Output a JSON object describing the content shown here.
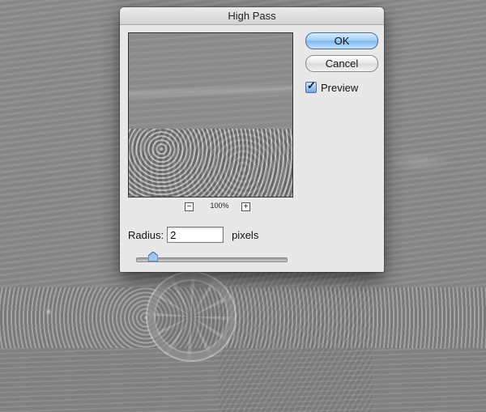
{
  "dialog": {
    "title": "High Pass",
    "ok_label": "OK",
    "cancel_label": "Cancel",
    "preview_label": "Preview",
    "preview_checked": true,
    "zoom_level": "100%",
    "zoom_out_symbol": "−",
    "zoom_in_symbol": "+",
    "radius_label": "Radius:",
    "radius_value": "2",
    "units_label": "pixels",
    "radius_slider_fraction": 0.08
  },
  "colors": {
    "ok_accent": "#7ab6ee",
    "dialog_bg": "#e8e8e8",
    "canvas_gray": "#888888"
  },
  "icons": {
    "zoom_out": "minus-icon",
    "zoom_in": "plus-icon",
    "checkmark": "checkmark-icon",
    "slider_thumb": "triangle-thumb-icon"
  }
}
